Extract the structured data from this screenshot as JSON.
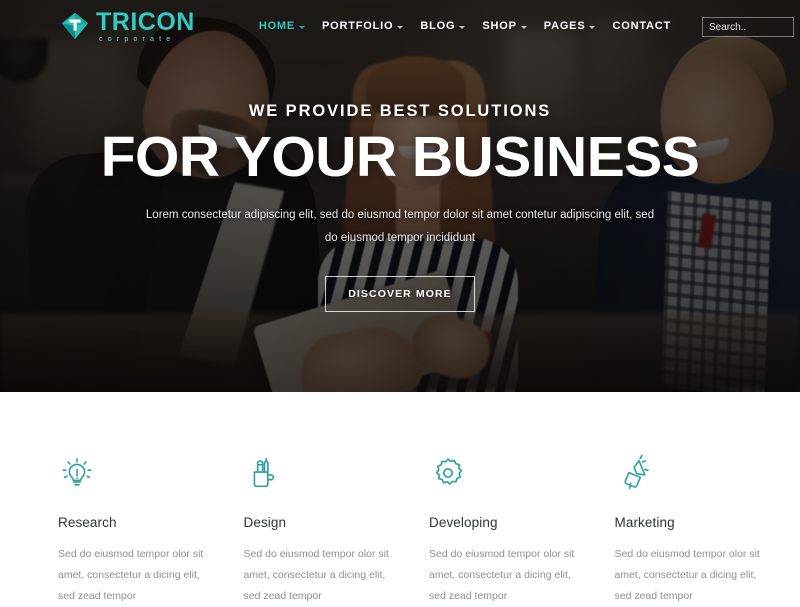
{
  "brand": {
    "name": "TRICON",
    "tagline": "corporate",
    "logo_icon": "diamond-logo-icon",
    "accent_color": "#34c9bf"
  },
  "nav": {
    "items": [
      {
        "label": "HOME",
        "active": true,
        "has_dropdown": true
      },
      {
        "label": "PORTFOLIO",
        "active": false,
        "has_dropdown": true
      },
      {
        "label": "BLOG",
        "active": false,
        "has_dropdown": true
      },
      {
        "label": "SHOP",
        "active": false,
        "has_dropdown": true
      },
      {
        "label": "PAGES",
        "active": false,
        "has_dropdown": true
      },
      {
        "label": "CONTACT",
        "active": false,
        "has_dropdown": false
      }
    ]
  },
  "search": {
    "placeholder": "Search..",
    "value": ""
  },
  "hero": {
    "kicker": "WE PROVIDE BEST SOLUTIONS",
    "title": "FOR YOUR BUSINESS",
    "subtitle": "Lorem consectetur adipiscing elit, sed do eiusmod tempor dolor sit amet contetur  adipiscing elit, sed do eiusmod tempor incididunt",
    "cta_label": "DISCOVER MORE"
  },
  "services": {
    "accent_color": "#2fa0a0",
    "items": [
      {
        "icon": "lightbulb-icon",
        "title": "Research",
        "text": "Sed do eiusmod tempor olor sit amet, consectetur a dicing elit, sed zead tempor"
      },
      {
        "icon": "pencil-cup-icon",
        "title": "Design",
        "text": "Sed do eiusmod tempor olor sit amet, consectetur a dicing elit, sed zead tempor"
      },
      {
        "icon": "gear-icon",
        "title": "Developing",
        "text": "Sed do eiusmod tempor olor sit amet, consectetur a dicing elit, sed zead tempor"
      },
      {
        "icon": "megaphone-icon",
        "title": "Marketing",
        "text": "Sed do eiusmod tempor olor sit amet, consectetur a dicing elit, sed zead tempor"
      }
    ]
  }
}
